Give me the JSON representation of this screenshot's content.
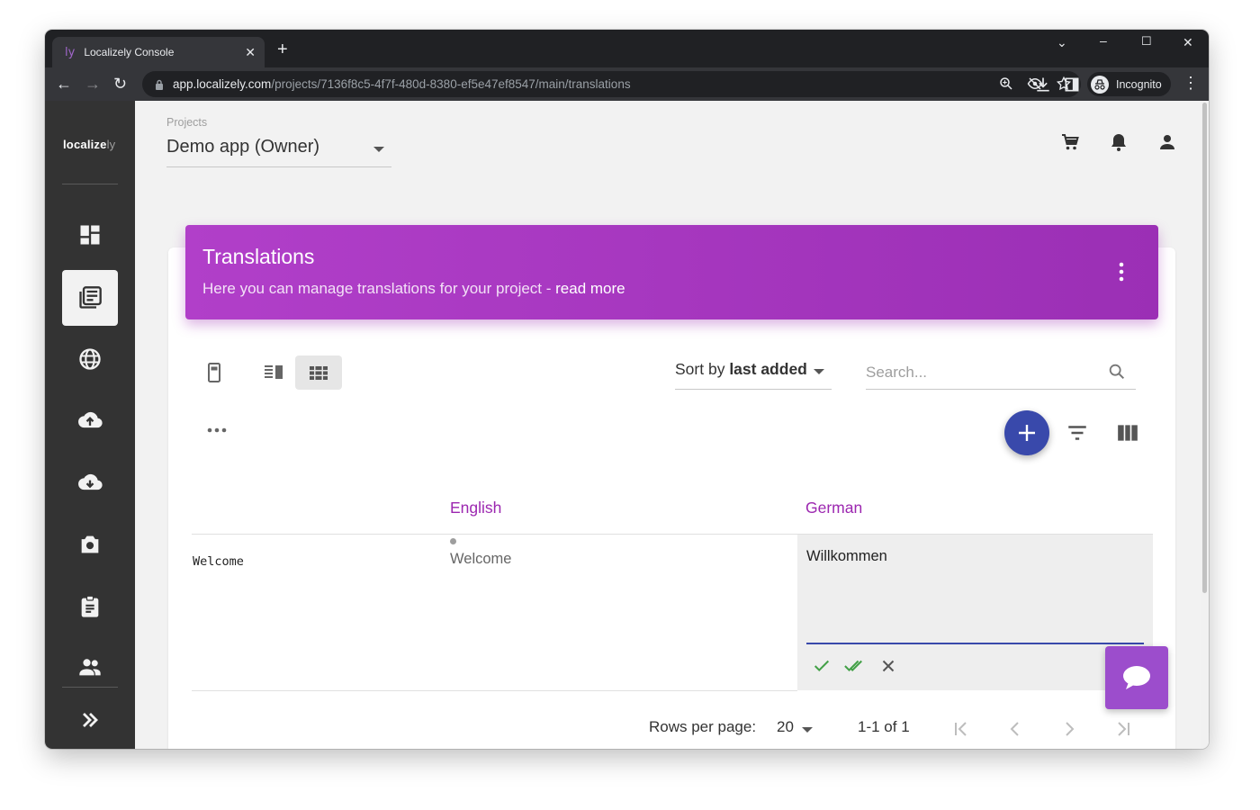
{
  "browser": {
    "tab_title": "Localizely Console",
    "tab_favicon": "ly",
    "url_host": "app.localizely.com",
    "url_path": "/projects/7136f8c5-4f7f-480d-8380-ef5e47ef8547/main/translations",
    "profile_label": "Incognito"
  },
  "sidebar": {
    "brand_main": "localize",
    "brand_suffix": "ly",
    "items": [
      {
        "icon": "dashboard-icon"
      },
      {
        "icon": "translations-icon",
        "active": true
      },
      {
        "icon": "languages-globe-icon"
      },
      {
        "icon": "upload-icon"
      },
      {
        "icon": "download-icon"
      },
      {
        "icon": "screenshots-camera-icon"
      },
      {
        "icon": "reports-clipboard-icon"
      },
      {
        "icon": "team-icon"
      },
      {
        "icon": "expand-icon"
      }
    ]
  },
  "header": {
    "projects_label": "Projects",
    "project_value": "Demo app (Owner)"
  },
  "banner": {
    "title": "Translations",
    "subtitle": "Here you can manage translations for your project - ",
    "link": "read more"
  },
  "toolbar": {
    "sort_prefix": "Sort by ",
    "sort_value": "last added",
    "search_placeholder": "Search..."
  },
  "table": {
    "columns": [
      "English",
      "German"
    ],
    "rows": [
      {
        "key": "Welcome",
        "english": "Welcome",
        "german": "Willkommen"
      }
    ]
  },
  "pagination": {
    "rows_per_page_label": "Rows per page:",
    "rows_per_page_value": "20",
    "range": "1-1 of 1"
  },
  "colors": {
    "accent_purple": "#9c27b0",
    "fab_blue": "#3949ab",
    "sidebar_bg": "#333333"
  }
}
